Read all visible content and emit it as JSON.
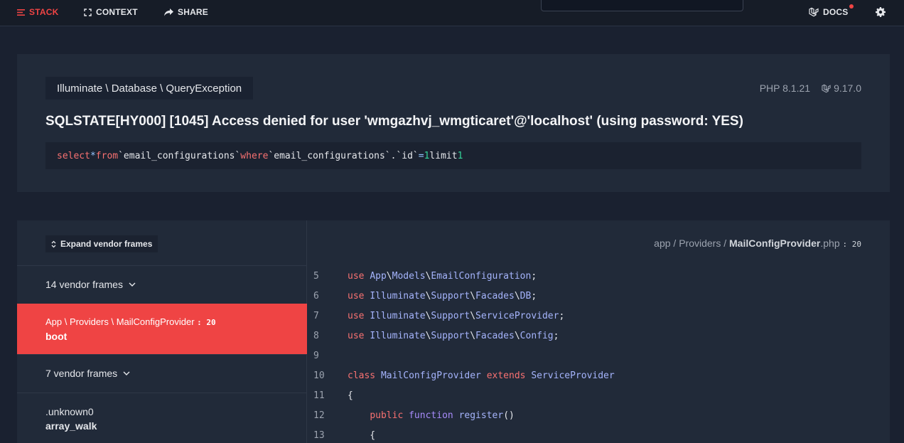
{
  "nav": {
    "stack": "STACK",
    "context": "CONTEXT",
    "share": "SHARE",
    "docs": "DOCS"
  },
  "exception": {
    "class_path": "Illuminate \\ Database \\ QueryException",
    "php_version": "PHP 8.1.21",
    "laravel_version": "9.17.0",
    "message": "SQLSTATE[HY000] [1045] Access denied for user 'wmgazhvj_wmgticaret'@'localhost' (using password: YES)",
    "sql": {
      "select": "select",
      "star": "*",
      "from": "from",
      "table": "`email_configurations`",
      "where": "where",
      "column": "`email_configurations`.`id`",
      "eq": "=",
      "val": "1",
      "limit": "limit",
      "limit_val": "1"
    }
  },
  "stack": {
    "expand_label": "Expand vendor frames",
    "frames": [
      {
        "label": "14 vendor frames"
      },
      {
        "class": "App \\ Providers \\ MailConfigProvider",
        "line": ": 20",
        "method": "boot"
      },
      {
        "label": "7 vendor frames"
      },
      {
        "class": ".unknown0",
        "method": "array_walk"
      }
    ],
    "file": {
      "dir": "app / Providers /",
      "name": "MailConfigProvider",
      "ext": ".php",
      "line": ": 20"
    }
  },
  "code": {
    "lines": [
      {
        "no": "5",
        "t": [
          [
            "use ",
            "c-kw"
          ],
          [
            "App",
            "c-ns"
          ],
          [
            "\\",
            "c-pl"
          ],
          [
            "Models",
            "c-ns"
          ],
          [
            "\\",
            "c-pl"
          ],
          [
            "EmailConfiguration",
            "c-ns"
          ],
          [
            ";",
            "c-pl"
          ]
        ]
      },
      {
        "no": "6",
        "t": [
          [
            "use ",
            "c-kw"
          ],
          [
            "Illuminate",
            "c-ns"
          ],
          [
            "\\",
            "c-pl"
          ],
          [
            "Support",
            "c-ns"
          ],
          [
            "\\",
            "c-pl"
          ],
          [
            "Facades",
            "c-ns"
          ],
          [
            "\\",
            "c-pl"
          ],
          [
            "DB",
            "c-ns"
          ],
          [
            ";",
            "c-pl"
          ]
        ]
      },
      {
        "no": "7",
        "t": [
          [
            "use ",
            "c-kw"
          ],
          [
            "Illuminate",
            "c-ns"
          ],
          [
            "\\",
            "c-pl"
          ],
          [
            "Support",
            "c-ns"
          ],
          [
            "\\",
            "c-pl"
          ],
          [
            "ServiceProvider",
            "c-ns"
          ],
          [
            ";",
            "c-pl"
          ]
        ]
      },
      {
        "no": "8",
        "t": [
          [
            "use ",
            "c-kw"
          ],
          [
            "Illuminate",
            "c-ns"
          ],
          [
            "\\",
            "c-pl"
          ],
          [
            "Support",
            "c-ns"
          ],
          [
            "\\",
            "c-pl"
          ],
          [
            "Facades",
            "c-ns"
          ],
          [
            "\\",
            "c-pl"
          ],
          [
            "Config",
            "c-ns"
          ],
          [
            ";",
            "c-pl"
          ]
        ]
      },
      {
        "no": "9",
        "t": []
      },
      {
        "no": "10",
        "t": [
          [
            "class ",
            "c-kw"
          ],
          [
            "MailConfigProvider ",
            "c-ns"
          ],
          [
            "extends ",
            "c-kw"
          ],
          [
            "ServiceProvider",
            "c-ns"
          ]
        ]
      },
      {
        "no": "11",
        "t": [
          [
            "{",
            "c-pl"
          ]
        ]
      },
      {
        "no": "12",
        "t": [
          [
            "    ",
            "c-pl"
          ],
          [
            "public ",
            "c-kw"
          ],
          [
            "function ",
            "c-fn"
          ],
          [
            "register",
            "c-ns"
          ],
          [
            "()",
            "c-pl"
          ]
        ]
      },
      {
        "no": "13",
        "t": [
          [
            "    {",
            "c-pl"
          ]
        ]
      }
    ]
  }
}
